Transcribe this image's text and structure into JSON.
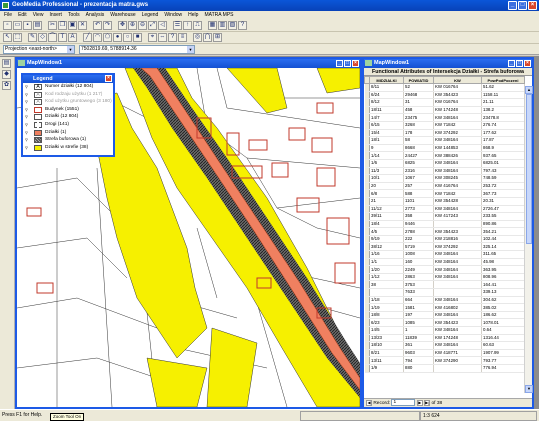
{
  "window": {
    "title": "GeoMedia Professional - prezentacja matra.gws",
    "buttons": [
      "_",
      "□",
      "×"
    ]
  },
  "menu": [
    "File",
    "Edit",
    "View",
    "Insert",
    "Tools",
    "Analysis",
    "Warehouse",
    "Legend",
    "Window",
    "Help",
    "MATRA MPS"
  ],
  "projection_row": {
    "projection": "Projection <east-north>",
    "coords": "7502819.69, 5788914.36"
  },
  "map_window": {
    "title": "MapWindow1"
  },
  "legend": {
    "title": "Legend",
    "items": [
      {
        "label": "Numer działki (12 804)",
        "swatch": "A",
        "swatch_color": "#ffffff",
        "grey": false
      },
      {
        "label": "Kod rodzaju użytku (1 217)",
        "swatch": "A",
        "swatch_color": "#ffffff",
        "grey": true
      },
      {
        "label": "Kod użytku gruntowego (3 180)",
        "swatch": "A",
        "swatch_color": "#ffffff",
        "grey": true
      },
      {
        "label": "Budynek (1551)",
        "swatch": "",
        "swatch_color": "#ffffff",
        "grey": false
      },
      {
        "label": "Działki (12 804)",
        "swatch": "",
        "swatch_color": "#ffffff",
        "grey": false
      },
      {
        "label": "Drogi (141)",
        "swatch": "",
        "swatch_color": "#ffffff",
        "grey": false
      },
      {
        "label": "Działki (1)",
        "swatch": "",
        "swatch_color": "#f08060",
        "grey": false
      },
      {
        "label": "Strefa buforowa (1)",
        "swatch": "",
        "swatch_color": "#404040",
        "grey": false
      },
      {
        "label": "Działki w strefie (38)",
        "swatch": "",
        "swatch_color": "#f6f000",
        "grey": false
      }
    ]
  },
  "attr_window": {
    "title": "MapWindow1",
    "header": "Functional Attributes of Intersekcja Działki - Strefa buforowa",
    "columns": [
      "MIDZIALKI",
      "POWIATID",
      "KW",
      "PowPodPoczeni"
    ],
    "rows": [
      [
        "8/11",
        "52",
        "KW 016764",
        "51.62"
      ],
      [
        "6/24",
        "29468",
        "KW 354423",
        "1158.11"
      ],
      [
        "8/12",
        "31",
        "KW 016764",
        "21.11"
      ],
      [
        "18/11",
        "458",
        "KW 174248",
        "138.2"
      ],
      [
        "14/7",
        "23475",
        "KW 348164",
        "23478.8"
      ],
      [
        "6/15",
        "3268",
        "KW 71842",
        "276.74"
      ],
      [
        "15/4",
        "178",
        "KW 374292",
        "177.62"
      ],
      [
        "18/1",
        "58",
        "KW 348164",
        "17.87"
      ],
      [
        "9",
        "8668",
        "KW 144853",
        "868.9"
      ],
      [
        "1/14",
        "24427",
        "KW 388426",
        "937.65"
      ],
      [
        "1/6",
        "6825",
        "KW 348164",
        "6825.01"
      ],
      [
        "11/3",
        "2316",
        "KW 348164",
        "797.43"
      ],
      [
        "10/1",
        "1067",
        "KW 308245",
        "748.59"
      ],
      [
        "20",
        "257",
        "KW 416764",
        "253.72"
      ],
      [
        "6/8",
        "588",
        "KW 71842",
        "367.73"
      ],
      [
        "21",
        "1101",
        "KW 354428",
        "20.31"
      ],
      [
        "11/12",
        "2773",
        "KW 348164",
        "2726.47"
      ],
      [
        "39/11",
        "358",
        "KW 417243",
        "233.55"
      ],
      [
        "18/4",
        "9446",
        "",
        "890.86"
      ],
      [
        "4/5",
        "2788",
        "KW 354423",
        "354.21"
      ],
      [
        "9/19",
        "222",
        "KW 218816",
        "102.44"
      ],
      [
        "38/12",
        "5719",
        "KW 374292",
        "325.14"
      ],
      [
        "1/16",
        "1008",
        "KW 348164",
        "311.65"
      ],
      [
        "1/1",
        "160",
        "KW 348164",
        "45.98"
      ],
      [
        "1/20",
        "2249",
        "KW 348164",
        "363.95"
      ],
      [
        "1/12",
        "2863",
        "KW 348164",
        "808.96"
      ],
      [
        "38",
        "3753",
        "",
        "164.41"
      ],
      [
        "",
        "7633",
        "",
        "339.13"
      ],
      [
        "1/18",
        "664",
        "KW 348164",
        "304.62"
      ],
      [
        "1/19",
        "1581",
        "KW 416802",
        "385.02"
      ],
      [
        "18/8",
        "197",
        "KW 348164",
        "186.62"
      ],
      [
        "6/23",
        "1085",
        "KW 354423",
        "1078.01"
      ],
      [
        "14/5",
        "1",
        "KW 348164",
        "0.64"
      ],
      [
        "13/23",
        "11839",
        "KW 174248",
        "1316.44"
      ],
      [
        "18/10",
        "361",
        "KW 348164",
        "60.63"
      ],
      [
        "8/21",
        "9603",
        "KW 418771",
        "1907.99"
      ],
      [
        "13/11",
        "794",
        "KW 374290",
        "793.77"
      ],
      [
        "1/9",
        "880",
        "",
        "776.94"
      ]
    ],
    "nav": {
      "label": "Record:",
      "value": "1",
      "of": "of 38"
    }
  },
  "status": {
    "left": "Press F1 for Help.",
    "tooltip": "Zoom Tool On",
    "scale": "1:3 624"
  },
  "colors": {
    "road_yellow": "#f6f000",
    "parcel_orange": "#f08060",
    "buffer_dark": "#404040",
    "building_red": "#c0392b",
    "title_blue": "#1d5ae6"
  }
}
